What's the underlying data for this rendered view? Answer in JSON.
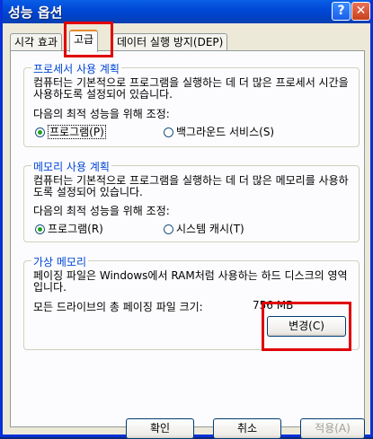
{
  "window": {
    "title": "성능 옵션",
    "help_glyph": "?",
    "close_glyph": "✕"
  },
  "tabs": [
    {
      "label": "시각 효과"
    },
    {
      "label": "고급"
    },
    {
      "label": "데이터 실행 방지(DEP)"
    }
  ],
  "processor": {
    "title": "프로세서 사용 계획",
    "desc": "컴퓨터는 기본적으로 프로그램을 실행하는 데 더 많은 프로세서 시간을 사용하도록 설정되어 있습니다.",
    "adjust_label": "다음의 최적 성능을 위해 조정:",
    "option_programs": "프로그램(P)",
    "option_services": "백그라운드 서비스(S)"
  },
  "memory": {
    "title": "메모리 사용 계획",
    "desc": "컴퓨터는 기본적으로 프로그램을 실행하는 데 더 많은 메모리를 사용하도록 설정되어 있습니다.",
    "adjust_label": "다음의 최적 성능을 위해 조정:",
    "option_programs": "프로그램(R)",
    "option_cache": "시스템 캐시(T)"
  },
  "virtual": {
    "title": "가상 메모리",
    "desc": "페이징 파일은 Windows에서 RAM처럼 사용하는 하드 디스크의 영역입니다.",
    "total_label": "모든 드라이브의 총 페이징 파일 크기:",
    "total_value": "756 MB",
    "change_button": "변경(C)"
  },
  "footer": {
    "ok": "확인",
    "cancel": "취소",
    "apply": "적용(A)"
  },
  "colors": {
    "highlight_box": "#e00000",
    "group_title": "#0046d5"
  }
}
